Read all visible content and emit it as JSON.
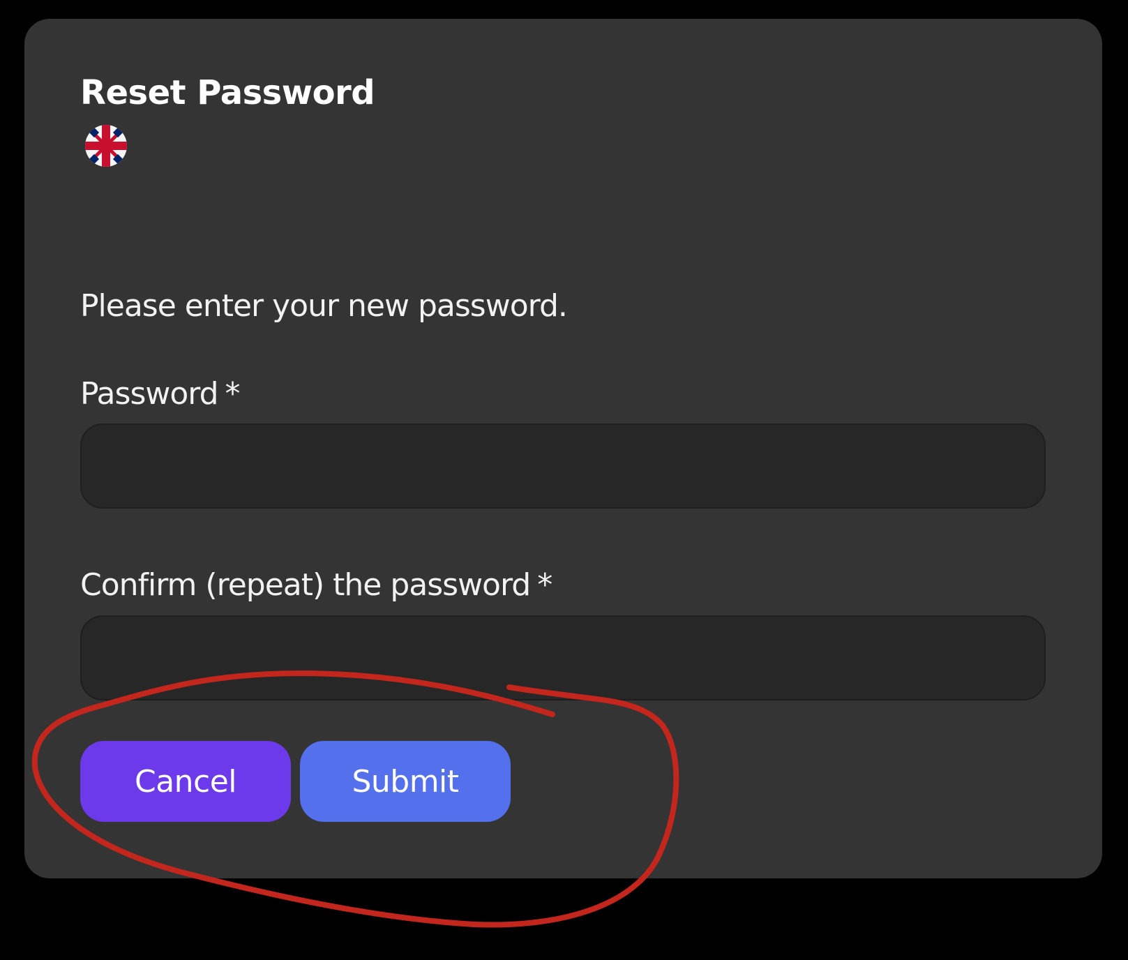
{
  "dialog": {
    "title": "Reset Password",
    "language_icon": "uk-flag-icon",
    "intro": "Please enter your new password."
  },
  "form": {
    "password_label": "Password",
    "confirm_label": "Confirm (repeat) the password",
    "required_marker": "*",
    "password_value": "",
    "confirm_value": ""
  },
  "actions": {
    "cancel_label": "Cancel",
    "submit_label": "Submit"
  },
  "colors": {
    "background": "#000000",
    "card": "#343434",
    "input": "#272727",
    "cancel_button": "#6c3aea",
    "submit_button": "#5470ec",
    "annotation_stroke": "#c3261c"
  }
}
